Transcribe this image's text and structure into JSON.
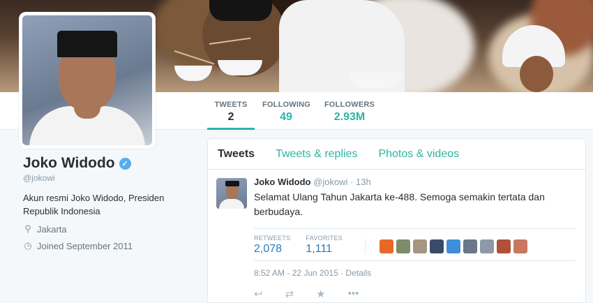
{
  "profile": {
    "name": "Joko Widodo",
    "handle": "@jokowi",
    "bio": "Akun resmi Joko Widodo, Presiden Republik Indonesia",
    "location": "Jakarta",
    "joined": "Joined September 2011",
    "verified_glyph": "✓"
  },
  "stats": {
    "tweets_label": "TWEETS",
    "tweets_value": "2",
    "following_label": "FOLLOWING",
    "following_value": "49",
    "followers_label": "FOLLOWERS",
    "followers_value": "2.93M"
  },
  "tabs": [
    {
      "label": "Tweets"
    },
    {
      "label": "Tweets & replies"
    },
    {
      "label": "Photos & videos"
    }
  ],
  "tweet": {
    "author": "Joko Widodo",
    "handle": "@jokowi",
    "time": "· 13h",
    "text": "Selamat Ulang Tahun Jakarta ke-488. Semoga semakin tertata dan berbudaya.",
    "retweets_label": "RETWEETS",
    "retweets_value": "2,078",
    "favorites_label": "FAVORITES",
    "favorites_value": "1,111",
    "date": "8:52 AM - 22 Jun 2015",
    "details_label": "· Details"
  },
  "icons": {
    "reply": "↩",
    "retweet": "⇄",
    "favorite": "★",
    "more": "•••",
    "location": "⚲",
    "calendar": "◷"
  },
  "colors": {
    "accent": "#2bb5a5",
    "link": "#2b7bb9",
    "verified": "#55acee"
  }
}
